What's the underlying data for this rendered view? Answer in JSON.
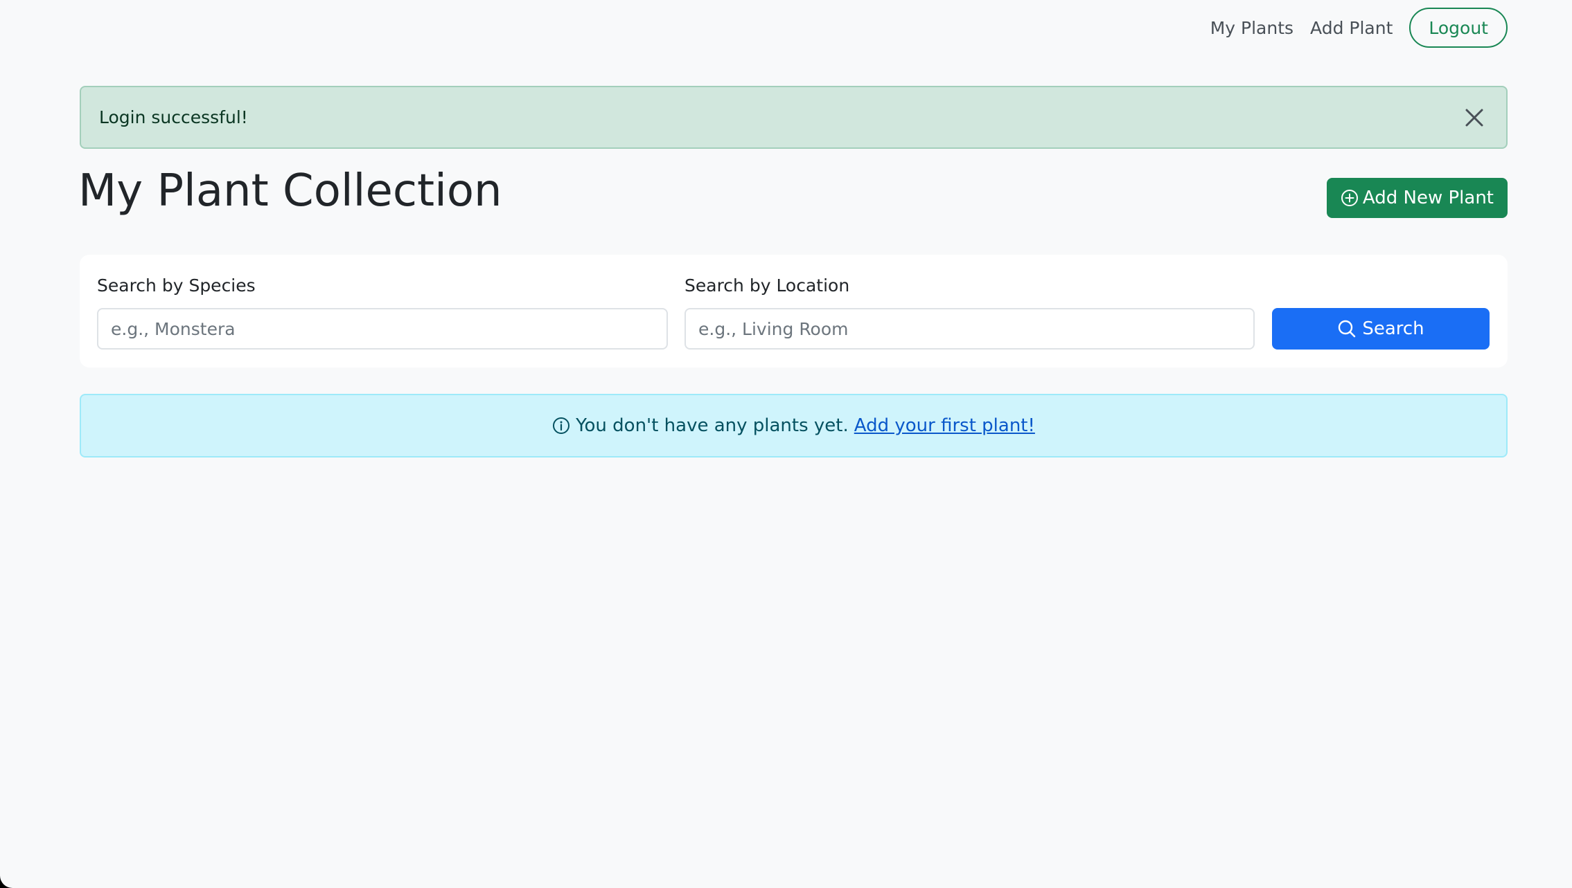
{
  "nav": {
    "links": [
      {
        "label": "My Plants"
      },
      {
        "label": "Add Plant"
      }
    ],
    "logout_label": "Logout"
  },
  "alert": {
    "message": "Login successful!"
  },
  "header": {
    "title": "My Plant Collection",
    "add_button_label": "Add New Plant"
  },
  "search": {
    "species_label": "Search by Species",
    "species_placeholder": "e.g., Monstera",
    "location_label": "Search by Location",
    "location_placeholder": "e.g., Living Room",
    "button_label": "Search"
  },
  "empty_state": {
    "message": "You don't have any plants yet.",
    "link_label": "Add your first plant!"
  },
  "colors": {
    "success": "#198754",
    "primary": "#1a6ef5",
    "alert_success_bg": "#d1e7dd",
    "alert_info_bg": "#cff4fc"
  },
  "icons": {
    "close": "close-icon",
    "add": "plus-circle-icon",
    "search": "search-icon",
    "info": "info-circle-icon"
  }
}
